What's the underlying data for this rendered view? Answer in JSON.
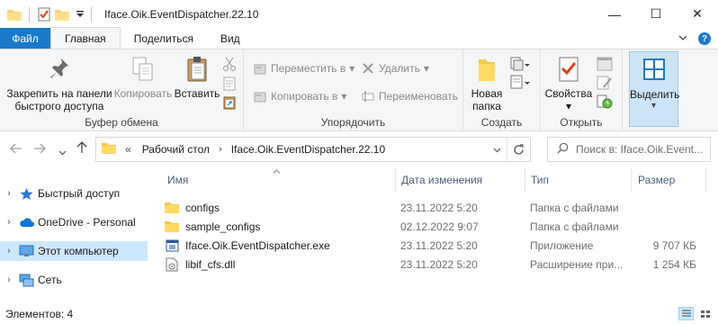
{
  "window": {
    "title": "Iface.Oik.EventDispatcher.22.10",
    "controls": {
      "minimize": "—",
      "maximize": "☐",
      "close": "✕"
    }
  },
  "ribbon_tabs": [
    "Файл",
    "Главная",
    "Поделиться",
    "Вид"
  ],
  "ribbon": {
    "clipboard": {
      "label": "Буфер обмена",
      "pin": "Закрепить на панели быстрого доступа",
      "pin_line1": "Закрепить на панели",
      "pin_line2": "быстрого доступа",
      "copy": "Копировать",
      "paste": "Вставить"
    },
    "organize": {
      "label": "Упорядочить",
      "move_to": "Переместить в",
      "copy_to": "Копировать в",
      "delete": "Удалить",
      "rename": "Переименовать"
    },
    "new": {
      "label": "Создать",
      "new_folder": "Новая папка",
      "new_folder_line1": "Новая",
      "new_folder_line2": "папка"
    },
    "open": {
      "label": "Открыть",
      "properties": "Свойства"
    },
    "select": {
      "label": "Выделить"
    }
  },
  "address": {
    "crumbs_overflow": "«",
    "crumbs": [
      "Рабочий стол",
      "Iface.Oik.EventDispatcher.22.10"
    ],
    "search_placeholder": "Поиск в: Iface.Oik.Event..."
  },
  "nav_pane": [
    {
      "label": "Быстрый доступ",
      "icon": "star-icon"
    },
    {
      "label": "OneDrive - Personal",
      "icon": "cloud-icon"
    },
    {
      "label": "Этот компьютер",
      "icon": "computer-icon",
      "selected": true
    },
    {
      "label": "Сеть",
      "icon": "network-icon"
    }
  ],
  "columns": {
    "name": "Имя",
    "date": "Дата изменения",
    "type": "Тип",
    "size": "Размер"
  },
  "files": [
    {
      "name": "configs",
      "date": "23.11.2022 5:20",
      "type": "Папка с файлами",
      "size": "",
      "icon": "folder-icon"
    },
    {
      "name": "sample_configs",
      "date": "02.12.2022 9:07",
      "type": "Папка с файлами",
      "size": "",
      "icon": "folder-icon"
    },
    {
      "name": "Iface.Oik.EventDispatcher.exe",
      "date": "23.11.2022 5:20",
      "type": "Приложение",
      "size": "9 707 КБ",
      "icon": "exe-icon"
    },
    {
      "name": "libif_cfs.dll",
      "date": "23.11.2022 5:20",
      "type": "Расширение при...",
      "size": "1 254 КБ",
      "icon": "dll-icon"
    }
  ],
  "status": {
    "items_count": "Элементов: 4"
  },
  "colors": {
    "accent": "#1979ca",
    "selection": "#cce8ff",
    "folder": "#f8d775",
    "column_header": "#4c607a"
  }
}
